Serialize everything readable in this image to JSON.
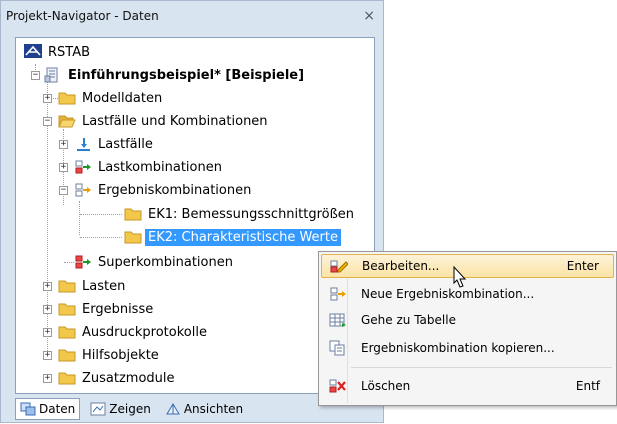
{
  "panel": {
    "title": "Projekt-Navigator - Daten",
    "close": "×"
  },
  "tree": {
    "root": "RSTAB",
    "project": "Einführungsbeispiel* [Beispiele]",
    "items": {
      "modelldaten": "Modelldaten",
      "lastfaelle_komb": "Lastfälle und Kombinationen",
      "lastfaelle": "Lastfälle",
      "lastkombinationen": "Lastkombinationen",
      "ergebniskombinationen": "Ergebniskombinationen",
      "ek1": "EK1: Bemessungsschnittgrößen",
      "ek2": "EK2: Charakteristische Werte",
      "superkombinationen": "Superkombinationen",
      "lasten": "Lasten",
      "ergebnisse": "Ergebnisse",
      "ausdruckprotokolle": "Ausdruckprotokolle",
      "hilfsobjekte": "Hilfsobjekte",
      "zusatzmodule": "Zusatzmodule"
    }
  },
  "tabs": {
    "daten": "Daten",
    "zeigen": "Zeigen",
    "ansichten": "Ansichten"
  },
  "context_menu": {
    "bearbeiten": "Bearbeiten...",
    "bearbeiten_shortcut": "Enter",
    "neue": "Neue Ergebniskombination...",
    "gehe": "Gehe zu Tabelle",
    "kopieren": "Ergebniskombination kopieren...",
    "loeschen": "Löschen",
    "loeschen_shortcut": "Entf"
  },
  "icons": {
    "rstab": "rstab-logo-icon",
    "project": "project-icon",
    "folder": "folder-icon",
    "loadcase": "load-case-icon",
    "combination": "combination-icon",
    "edit": "edit-icon",
    "new": "new-combination-icon",
    "table": "table-icon",
    "copy": "copy-icon",
    "delete": "delete-icon"
  },
  "colors": {
    "selection": "#3399ff",
    "panel_bg": "#d9e4f1",
    "folder": "#f2c74a",
    "menu_hover": "#fbe3a4"
  }
}
